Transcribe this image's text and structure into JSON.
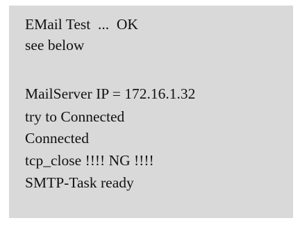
{
  "status_panel": {
    "lines": [
      "EMail Test  ...  OK",
      "see below",
      "",
      "MailServer IP = 172.16.1.32",
      "try to Connected",
      "Connected",
      "tcp_close !!!! NG !!!!",
      "SMTP-Task ready"
    ],
    "colors": {
      "background": "#d9d9d9",
      "text": "#111111"
    }
  }
}
